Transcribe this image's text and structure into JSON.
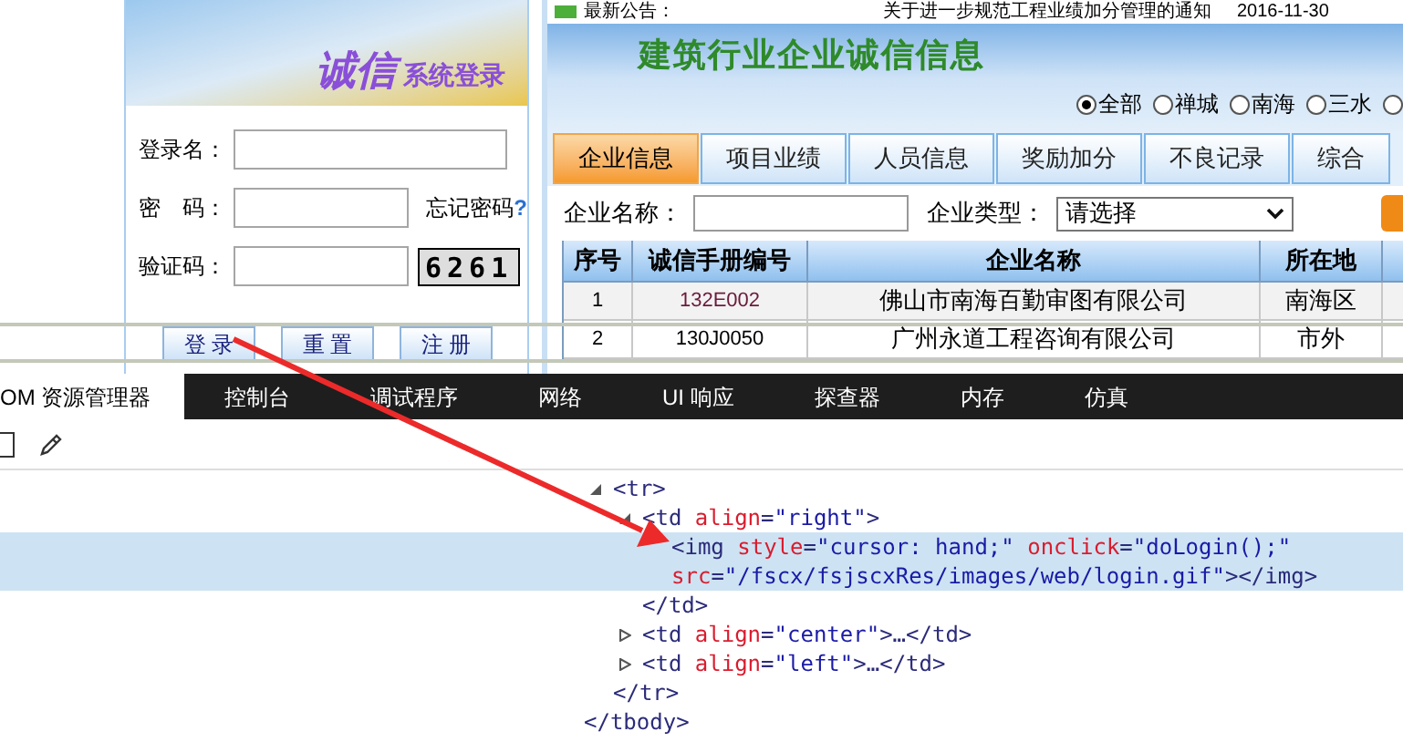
{
  "notice": {
    "label": "最新公告：",
    "text": "关于进一步规范工程业绩加分管理的通知",
    "date": "2016-11-30"
  },
  "login": {
    "banner_title": "诚信",
    "banner_subtitle": "系统登录",
    "fields": [
      {
        "label": "登录名：",
        "kind": "text"
      },
      {
        "label": "密　码：",
        "kind": "password",
        "link": "忘记密码",
        "link_mark": "?"
      },
      {
        "label": "验证码：",
        "kind": "captcha",
        "captcha": "6261"
      }
    ],
    "buttons": [
      "登 录",
      "重 置",
      "注 册"
    ]
  },
  "portal": {
    "title": "建筑行业企业诚信信息",
    "regions": [
      {
        "label": "全部",
        "selected": true
      },
      {
        "label": "禅城",
        "selected": false
      },
      {
        "label": "南海",
        "selected": false
      },
      {
        "label": "三水",
        "selected": false
      },
      {
        "selected": false
      }
    ],
    "tabs": [
      {
        "label": "企业信息",
        "selected": true
      },
      {
        "label": "项目业绩",
        "selected": false
      },
      {
        "label": "人员信息",
        "selected": false
      },
      {
        "label": "奖励加分",
        "selected": false
      },
      {
        "label": "不良记录",
        "selected": false
      },
      {
        "label": "综合",
        "selected": false
      }
    ],
    "search": {
      "name_label": "企业名称：",
      "type_label": "企业类型：",
      "type_value": "请选择"
    },
    "table": {
      "columns": [
        "序号",
        "诚信手册编号",
        "企业名称",
        "所在地"
      ],
      "rows": [
        [
          "1",
          "132E002",
          "佛山市南海百勤审图有限公司",
          "南海区"
        ],
        [
          "2",
          "130J0050",
          "广州永道工程咨询有限公司",
          "市外"
        ]
      ]
    }
  },
  "devtools": {
    "tabs": [
      {
        "label": "OM 资源管理器",
        "selected": true
      },
      {
        "label": "控制台",
        "selected": false
      },
      {
        "label": "调试程序",
        "selected": false
      },
      {
        "label": "网络",
        "selected": false
      },
      {
        "label": "UI 响应",
        "selected": false
      },
      {
        "label": "探查器",
        "selected": false
      },
      {
        "label": "内存",
        "selected": false
      },
      {
        "label": "仿真",
        "selected": false
      }
    ],
    "tree": [
      {
        "selected": false,
        "expanded": true,
        "lines": [
          [
            {
              "kind": "tag",
              "text": "<tr>"
            }
          ]
        ],
        "children": [
          {
            "selected": false,
            "expanded": true,
            "lines": [
              [
                {
                  "kind": "tag",
                  "text": "<td"
                },
                {
                  "kind": "attr",
                  "text": " align"
                },
                {
                  "kind": "tag",
                  "text": "="
                },
                {
                  "kind": "value",
                  "text": "\"right\""
                },
                {
                  "kind": "tag",
                  "text": ">"
                }
              ]
            ],
            "children": [
              {
                "selected": true,
                "lines": [
                  [
                    {
                      "kind": "tag",
                      "text": "<img"
                    },
                    {
                      "kind": "attr",
                      "text": " style"
                    },
                    {
                      "kind": "tag",
                      "text": "="
                    },
                    {
                      "kind": "value",
                      "text": "\"cursor: hand;\""
                    },
                    {
                      "kind": "attr",
                      "text": " onclick"
                    },
                    {
                      "kind": "tag",
                      "text": "="
                    },
                    {
                      "kind": "value",
                      "text": "\"doLogin();\""
                    }
                  ],
                  [
                    {
                      "kind": "attr",
                      "text": "src"
                    },
                    {
                      "kind": "tag",
                      "text": "="
                    },
                    {
                      "kind": "value",
                      "text": "\"/fscx/fsjscxRes/images/web/login.gif\""
                    },
                    {
                      "kind": "tag",
                      "text": "></img>"
                    }
                  ]
                ]
              }
            ],
            "close": [
              {
                "kind": "tag",
                "text": "</td>"
              }
            ]
          },
          {
            "selected": false,
            "expanded": false,
            "lines": [
              [
                {
                  "kind": "tag",
                  "text": "<td"
                },
                {
                  "kind": "attr",
                  "text": " align"
                },
                {
                  "kind": "tag",
                  "text": "="
                },
                {
                  "kind": "value",
                  "text": "\"center\""
                },
                {
                  "kind": "tag",
                  "text": ">…</td>"
                }
              ]
            ]
          },
          {
            "selected": false,
            "expanded": false,
            "lines": [
              [
                {
                  "kind": "tag",
                  "text": "<td"
                },
                {
                  "kind": "attr",
                  "text": " align"
                },
                {
                  "kind": "tag",
                  "text": "="
                },
                {
                  "kind": "value",
                  "text": "\"left\""
                },
                {
                  "kind": "tag",
                  "text": ">…</td>"
                }
              ]
            ]
          }
        ],
        "close": [
          {
            "kind": "tag",
            "text": "</tr>"
          }
        ]
      }
    ],
    "tail": [
      {
        "kind": "tag",
        "text": "</tbody>"
      }
    ]
  }
}
